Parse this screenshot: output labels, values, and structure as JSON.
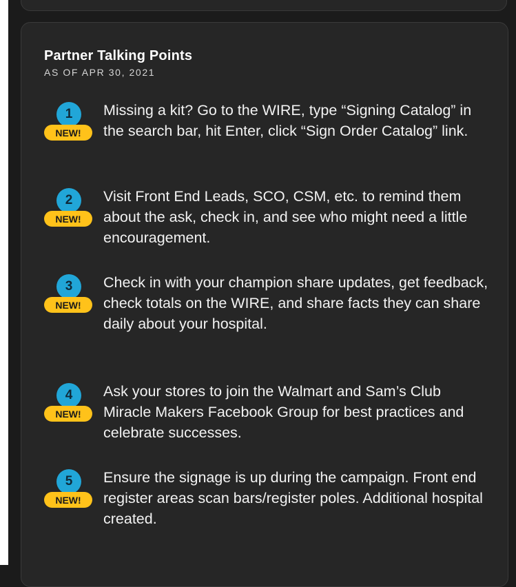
{
  "panel": {
    "title": "Partner Talking Points",
    "date": "AS OF APR 30, 2021"
  },
  "items": [
    {
      "number": "1",
      "badge": "NEW!",
      "text": "Missing a kit? Go to the WIRE, type “Signing Catalog” in the search bar, hit Enter, click “Sign Order Catalog” link."
    },
    {
      "number": "2",
      "badge": "NEW!",
      "text": "Visit Front End Leads, SCO, CSM, etc. to remind them about the ask, check in, and see who might need a little encouragement."
    },
    {
      "number": "3",
      "badge": "NEW!",
      "text": "Check in with your champion share updates, get feedback, check totals on the WIRE, and share facts they can share daily about your hospital."
    },
    {
      "number": "4",
      "badge": "NEW!",
      "text": "Ask your stores to join the Walmart and Sam’s Club Miracle Makers Facebook Group for best practices and celebrate successes."
    },
    {
      "number": "5",
      "badge": "NEW!",
      "text": "Ensure the signage is up during the campaign. Front end register areas scan bars/register poles. Additional hospital created."
    }
  ],
  "colors": {
    "background": "#1b1b1b",
    "panel": "#262626",
    "number_badge": "#21a6d8",
    "new_badge": "#ffc21a",
    "text": "#f2f2f2"
  }
}
